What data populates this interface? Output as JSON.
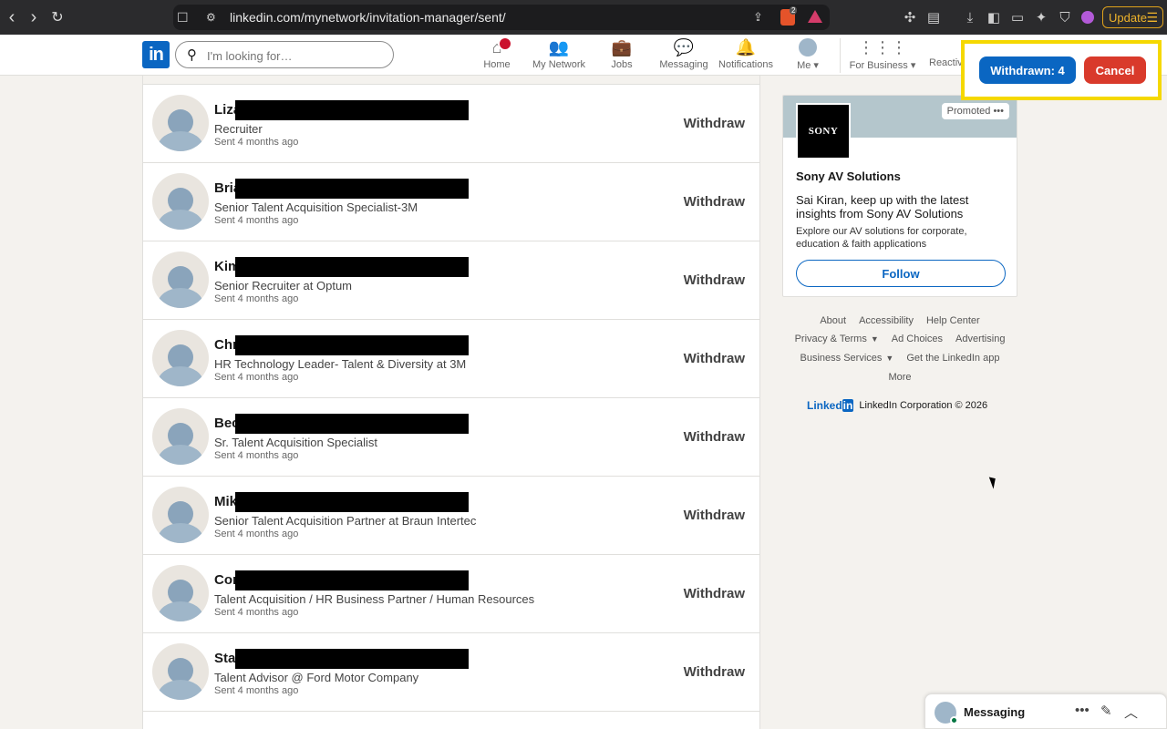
{
  "browser": {
    "url": "linkedin.com/mynetwork/invitation-manager/sent/",
    "update_label": "Update",
    "brave_badge": "2"
  },
  "nav": {
    "search_placeholder": "I'm looking for…",
    "items": [
      {
        "label": "Home",
        "icon": "home-icon"
      },
      {
        "label": "My Network",
        "icon": "network-icon"
      },
      {
        "label": "Jobs",
        "icon": "briefcase-icon"
      },
      {
        "label": "Messaging",
        "icon": "chat-icon"
      },
      {
        "label": "Notifications",
        "icon": "bell-icon"
      },
      {
        "label": "Me",
        "icon": "avatar-icon"
      },
      {
        "label": "For Business",
        "icon": "grid-icon"
      }
    ],
    "reactivate_partial": "Reactiv"
  },
  "invitations": [
    {
      "name": "Liza",
      "headline": "Recruiter",
      "sent": "Sent 4 months ago",
      "action": "Withdraw"
    },
    {
      "name": "Bria",
      "headline": "Senior Talent Acquisition Specialist-3M",
      "sent": "Sent 4 months ago",
      "action": "Withdraw"
    },
    {
      "name": "Kim",
      "headline": "Senior Recruiter at Optum",
      "sent": "Sent 4 months ago",
      "action": "Withdraw"
    },
    {
      "name": "Chr",
      "headline": "HR Technology Leader- Talent & Diversity at 3M",
      "sent": "Sent 4 months ago",
      "action": "Withdraw"
    },
    {
      "name": "Bec",
      "headline": "Sr. Talent Acquisition Specialist",
      "sent": "Sent 4 months ago",
      "action": "Withdraw"
    },
    {
      "name": "Mik",
      "headline": "Senior Talent Acquisition Partner at Braun Intertec",
      "sent": "Sent 4 months ago",
      "action": "Withdraw"
    },
    {
      "name": "Cor",
      "headline": "Talent Acquisition / HR Business Partner / Human Resources",
      "sent": "Sent 4 months ago",
      "action": "Withdraw"
    },
    {
      "name": "Sta",
      "headline": "Talent Advisor @ Ford Motor Company",
      "sent": "Sent 4 months ago",
      "action": "Withdraw"
    }
  ],
  "ad": {
    "promoted": "Promoted",
    "logo_text": "SONY",
    "company": "Sony AV Solutions",
    "headline": "Sai Kiran, keep up with the latest insights from Sony AV Solutions",
    "body": "Explore our AV solutions for corporate, education & faith applications",
    "follow_label": "Follow"
  },
  "footer": {
    "row1": [
      "About",
      "Accessibility",
      "Help Center"
    ],
    "row2": [
      "Privacy & Terms",
      "Ad Choices",
      "Advertising"
    ],
    "row3": [
      "Business Services",
      "Get the LinkedIn app"
    ],
    "row4": [
      "More"
    ],
    "brand_word": "Linked",
    "brand_in": "in",
    "copyright": "LinkedIn Corporation © 2026"
  },
  "overlay": {
    "withdrawn_label": "Withdrawn: 4",
    "cancel_label": "Cancel"
  },
  "messaging": {
    "title": "Messaging"
  }
}
